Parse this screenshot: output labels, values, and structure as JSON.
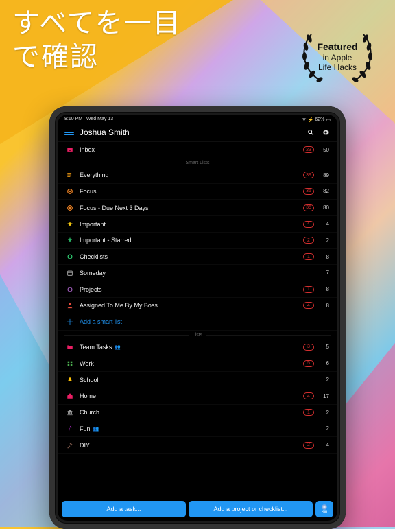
{
  "headline": "すべてを一目\nで確認",
  "laurel": {
    "line1": "Featured",
    "line2": "in Apple",
    "line3": "Life Hacks"
  },
  "status": {
    "time": "8:10 PM",
    "date": "Wed May 13",
    "battery": "62%"
  },
  "header": {
    "user": "Joshua Smith"
  },
  "section_smart": "Smart Lists",
  "section_lists": "Lists",
  "inbox": {
    "label": "Inbox",
    "badge": "23",
    "count": "50"
  },
  "smart": [
    {
      "label": "Everything",
      "badge": "39",
      "count": "89",
      "iconColor": "#f39c12",
      "icon": "list"
    },
    {
      "label": "Focus",
      "badge": "35",
      "count": "82",
      "iconColor": "#e67e22",
      "icon": "target"
    },
    {
      "label": "Focus - Due Next 3 Days",
      "badge": "35",
      "count": "80",
      "iconColor": "#e67e22",
      "icon": "target"
    },
    {
      "label": "Important",
      "badge": "4",
      "count": "4",
      "iconColor": "#f1c40f",
      "icon": "star"
    },
    {
      "label": "Important - Starred",
      "badge": "2",
      "count": "2",
      "iconColor": "#27ae60",
      "icon": "star"
    },
    {
      "label": "Checklists",
      "badge": "1",
      "count": "8",
      "iconColor": "#2ecc71",
      "icon": "circle"
    },
    {
      "label": "Someday",
      "badge": "",
      "count": "7",
      "iconColor": "#bbb",
      "icon": "cal"
    },
    {
      "label": "Projects",
      "badge": "1",
      "count": "8",
      "iconColor": "#9b59b6",
      "icon": "circle"
    },
    {
      "label": "Assigned To Me By My Boss",
      "badge": "4",
      "count": "8",
      "iconColor": "#e74c3c",
      "icon": "person"
    }
  ],
  "add_smart": "Add a smart list",
  "lists": [
    {
      "label": "Team Tasks",
      "people": true,
      "badge": "3",
      "count": "5",
      "iconColor": "#e91e63",
      "icon": "folder"
    },
    {
      "label": "Work",
      "people": false,
      "badge": "5",
      "count": "6",
      "iconColor": "#4caf50",
      "icon": "grid"
    },
    {
      "label": "School",
      "people": false,
      "badge": "",
      "count": "2",
      "iconColor": "#ffc107",
      "icon": "bell"
    },
    {
      "label": "Home",
      "people": false,
      "badge": "4",
      "count": "17",
      "iconColor": "#e91e63",
      "icon": "home"
    },
    {
      "label": "Church",
      "people": false,
      "badge": "1",
      "count": "2",
      "iconColor": "#9e9e9e",
      "icon": "bank"
    },
    {
      "label": "Fun",
      "people": true,
      "badge": "",
      "count": "2",
      "iconColor": "#9c27b0",
      "icon": "run"
    },
    {
      "label": "DIY",
      "people": false,
      "badge": "2",
      "count": "4",
      "iconColor": "#795548",
      "icon": "hammer"
    }
  ],
  "footer": {
    "add_task": "Add a task...",
    "add_project": "Add a project or checklist...",
    "siri": "Siri"
  }
}
